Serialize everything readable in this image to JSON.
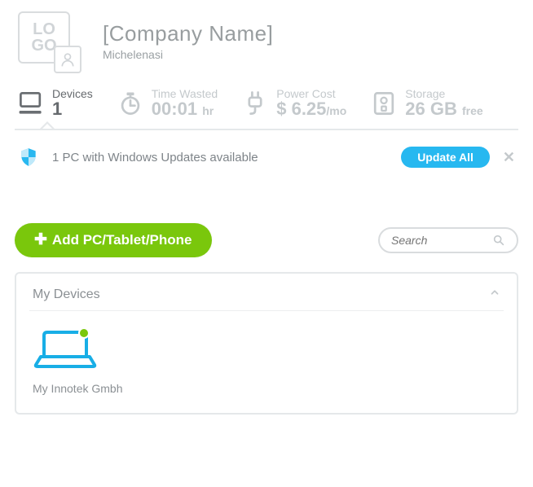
{
  "header": {
    "logo_line1": "LO",
    "logo_line2": "GO",
    "company_name": "[Company Name]",
    "user_name": "Michelenasi"
  },
  "stats": {
    "devices": {
      "label": "Devices",
      "value": "1"
    },
    "time_wasted": {
      "label": "Time Wasted",
      "value": "00:01",
      "unit": "hr"
    },
    "power_cost": {
      "label": "Power Cost",
      "value": "$ 6.25",
      "unit": "/mo"
    },
    "storage": {
      "label": "Storage",
      "value": "26 GB",
      "unit": "free"
    }
  },
  "notification": {
    "text": "1 PC with Windows Updates available",
    "update_label": "Update All"
  },
  "actions": {
    "add_label": "Add PC/Tablet/Phone",
    "search_placeholder": "Search"
  },
  "panel": {
    "title": "My Devices",
    "devices": [
      {
        "name": "My Innotek Gmbh"
      }
    ]
  }
}
